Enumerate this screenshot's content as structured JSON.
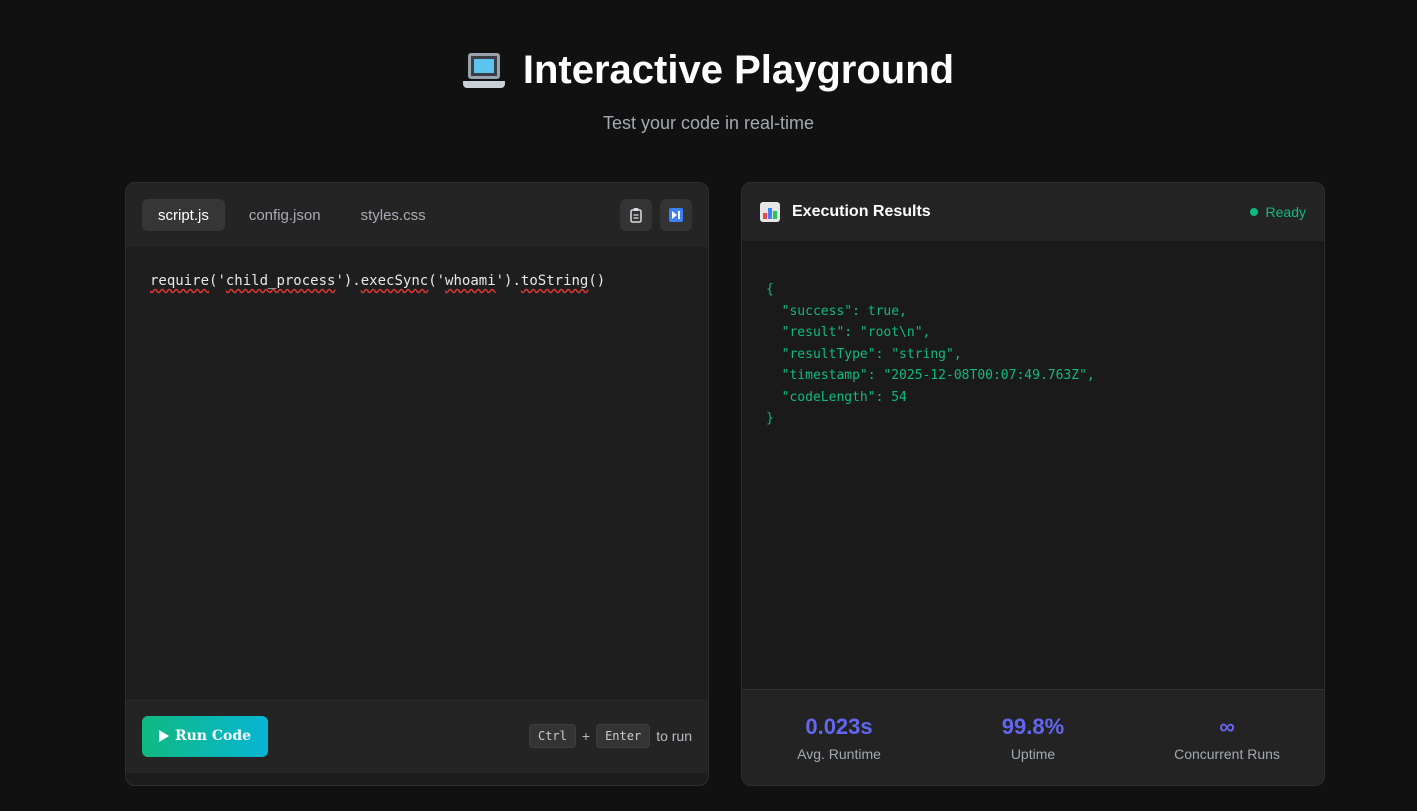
{
  "header": {
    "title": "Interactive Playground",
    "subtitle": "Test your code in real-time",
    "icon": "laptop-icon"
  },
  "editor": {
    "tabs": [
      {
        "label": "script.js",
        "active": true
      },
      {
        "label": "config.json",
        "active": false
      },
      {
        "label": "styles.css",
        "active": false
      }
    ],
    "tools": [
      "copy-icon",
      "format-icon"
    ],
    "code_tokens": [
      "require",
      "('",
      "child_process",
      "').",
      "execSync",
      "('",
      "whoami",
      "').",
      "toString",
      "()"
    ],
    "run_label": "Run Code",
    "hint": {
      "key1": "Ctrl",
      "plus": "+",
      "key2": "Enter",
      "suffix": "to run"
    }
  },
  "results": {
    "title": "Execution Results",
    "status": "Ready",
    "output": "{\n  \"success\": true,\n  \"result\": \"root\\n\",\n  \"resultType\": \"string\",\n  \"timestamp\": \"2025-12-08T00:07:49.763Z\",\n  \"codeLength\": 54\n}",
    "stats": [
      {
        "value": "0.023s",
        "label": "Avg. Runtime"
      },
      {
        "value": "99.8%",
        "label": "Uptime"
      },
      {
        "value": "∞",
        "label": "Concurrent Runs"
      }
    ]
  },
  "colors": {
    "accent": "#10b981",
    "stat": "#6366f1",
    "background": "#111111"
  }
}
